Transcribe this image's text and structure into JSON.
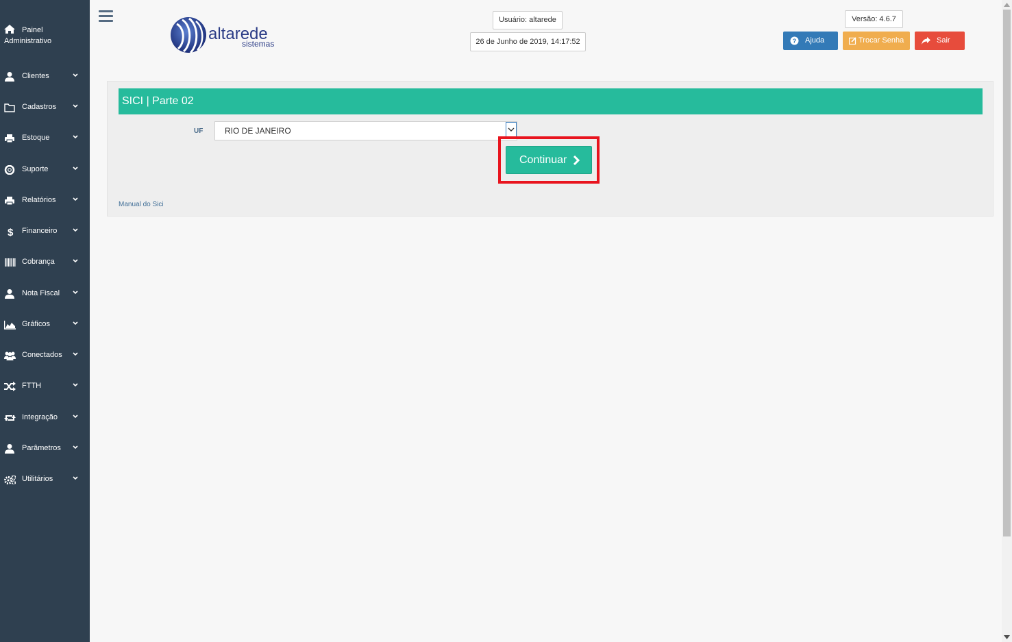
{
  "sidebar": {
    "home": {
      "label_line1": "Painel",
      "label_line2": "Administrativo",
      "icon": "home-icon"
    },
    "items": [
      {
        "label": "Clientes",
        "icon": "user-icon"
      },
      {
        "label": "Cadastros",
        "icon": "folder-icon"
      },
      {
        "label": "Estoque",
        "icon": "printer-icon"
      },
      {
        "label": "Suporte",
        "icon": "life-ring-icon"
      },
      {
        "label": "Relatórios",
        "icon": "printer-icon"
      },
      {
        "label": "Financeiro",
        "icon": "dollar-icon"
      },
      {
        "label": "Cobrança",
        "icon": "barcode-icon"
      },
      {
        "label": "Nota Fiscal",
        "icon": "user-icon"
      },
      {
        "label": "Gráficos",
        "icon": "area-chart-icon"
      },
      {
        "label": "Conectados",
        "icon": "users-icon"
      },
      {
        "label": "FTTH",
        "icon": "random-icon"
      },
      {
        "label": "Integração",
        "icon": "retweet-icon"
      },
      {
        "label": "Parâmetros",
        "icon": "user-icon"
      },
      {
        "label": "Utilitários",
        "icon": "cogs-icon"
      }
    ]
  },
  "header": {
    "logo_main": "altarede",
    "logo_sub": "sistemas",
    "user": "Usuário: altarede",
    "datetime": "26 de Junho de 2019, 14:17:52",
    "version": "Versão: 4.6.7",
    "help_label": "Ajuda",
    "change_password_label": "Trocar Senha",
    "logout_label": "Sair"
  },
  "panel": {
    "title": "SICI | Parte 02",
    "uf_label": "UF",
    "uf_value": "RIO DE JANEIRO",
    "continue_label": "Continuar",
    "manual_link": "Manual do Sici"
  },
  "colors": {
    "sidebar_bg": "#2f4050",
    "accent": "#26bb9c",
    "help": "#337ab7",
    "warning": "#f0ad4e",
    "danger": "#e74c3c",
    "highlight": "#e8141e"
  }
}
